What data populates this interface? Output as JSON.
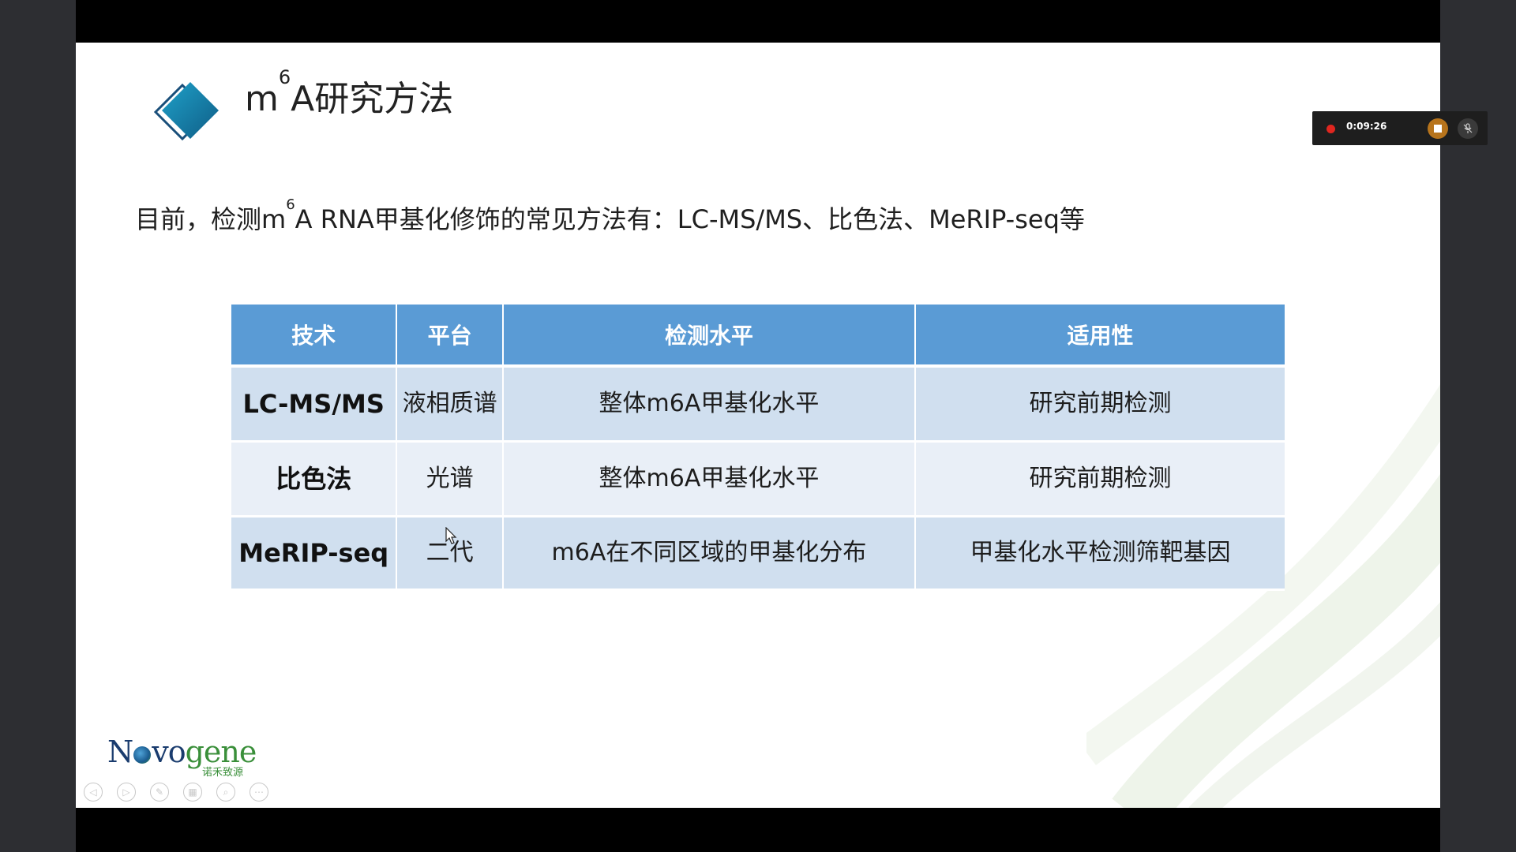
{
  "slide": {
    "title_prefix": "m",
    "title_sup": "6",
    "title_suffix": "A研究方法",
    "intro_prefix": "目前，检测m",
    "intro_sup": "6",
    "intro_suffix": "A RNA甲基化修饰的常见方法有：LC-MS/MS、比色法、MeRIP-seq等"
  },
  "table": {
    "headers": [
      "技术",
      "平台",
      "检测水平",
      "适用性"
    ],
    "rows": [
      {
        "tech": "LC-MS/MS",
        "platform": "液相质谱",
        "level": "整体m6A甲基化水平",
        "use": "研究前期检测"
      },
      {
        "tech": "比色法",
        "platform": "光谱",
        "level": "整体m6A甲基化水平",
        "use": "研究前期检测"
      },
      {
        "tech": "MeRIP-seq",
        "platform": "二代",
        "level": "m6A在不同区域的甲基化分布",
        "use": "甲基化水平检测筛靶基因"
      }
    ]
  },
  "brand": {
    "name_part1": "N",
    "name_part2": "vo",
    "name_part3": "gene",
    "subtitle": "诺禾致源"
  },
  "recorder": {
    "time": "0:09:26",
    "stop_icon": "stop-icon",
    "mic_icon": "mic-muted-icon"
  },
  "colors": {
    "header_blue": "#5a9bd5",
    "row_blue": "#d0dfef",
    "row_light": "#e9eff7",
    "record_red": "#e0261f",
    "stop_orange": "#b7741c"
  }
}
